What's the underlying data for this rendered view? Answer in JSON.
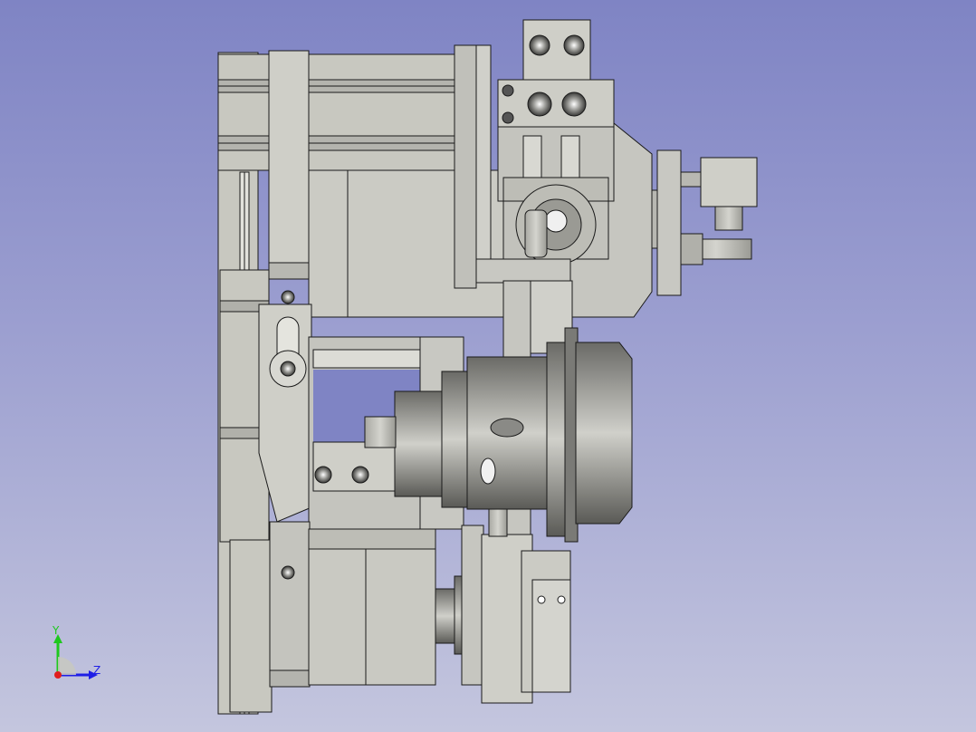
{
  "viewport": {
    "background_top": "#7f84c4",
    "background_bottom": "#c4c6de",
    "model_body_color": "#c8c8c0",
    "model_edge_color": "#1a1a1a",
    "model_shadow_color": "#8c8c86"
  },
  "axis_indicator": {
    "y_label": "Y",
    "z_label": "Z",
    "y_color": "#1ec81e",
    "z_color": "#1e1ee6",
    "origin_color": "#e01e1e"
  }
}
